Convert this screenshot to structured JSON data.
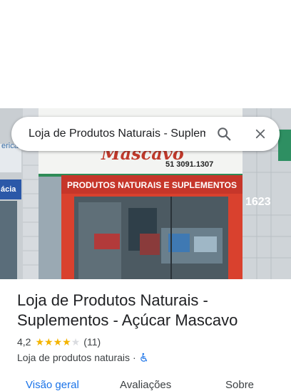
{
  "search": {
    "query": "Loja de Produtos Naturais - Suplementos - Açúcar Mascavo"
  },
  "photo": {
    "store_sign_script": "Mascavo",
    "store_phone": "51 3091.1307",
    "store_banner": "PRODUTOS NATURAIS E SUPLEMENTOS",
    "building_number": "1623",
    "left_sign_a": "erica",
    "left_sign_b": "ácia"
  },
  "place": {
    "title": "Loja de Produtos Naturais - Suplementos - Açúcar Mascavo",
    "rating": "4,2",
    "rating_value": 4.2,
    "review_count": "(11)",
    "category": "Loja de produtos naturais",
    "separator": "·"
  },
  "tabs": [
    {
      "label": "Visão geral"
    },
    {
      "label": "Avaliações"
    },
    {
      "label": "Sobre"
    }
  ],
  "colors": {
    "accent": "#1a73e8",
    "star": "#f4b400"
  }
}
